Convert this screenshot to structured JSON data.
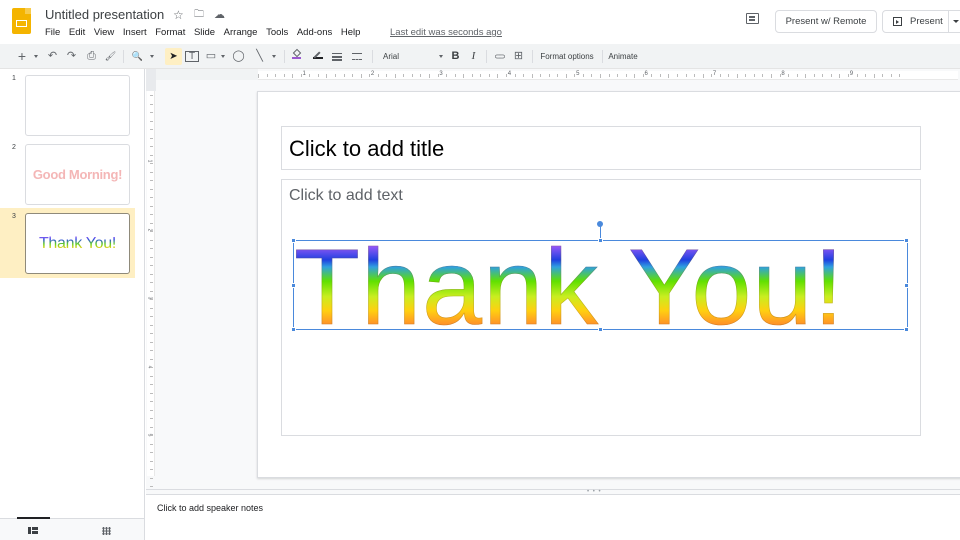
{
  "app": {
    "document_title": "Untitled presentation",
    "menu": [
      "File",
      "Edit",
      "View",
      "Insert",
      "Format",
      "Slide",
      "Arrange",
      "Tools",
      "Add-ons",
      "Help"
    ],
    "last_edit": "Last edit was seconds ago",
    "present_remote_label": "Present w/ Remote",
    "present_label": "Present",
    "icons": {
      "star": "☆",
      "move": "🗀",
      "cloud": "☁"
    }
  },
  "toolbar": {
    "font": "Arial",
    "bold": "B",
    "italic": "I",
    "format_options": "Format options",
    "animate": "Animate",
    "icons": {
      "new": "+",
      "undo": "↶",
      "redo": "↷",
      "print": "⎙",
      "paint_format": "🖌",
      "zoom": "🔍",
      "select": "➤",
      "textbox": "T",
      "image": "▭",
      "shape": "◯",
      "line": "╲",
      "link": "⊂⊃",
      "comment": "⊞"
    }
  },
  "filmstrip": {
    "slides": [
      {
        "number": "1",
        "text": ""
      },
      {
        "number": "2",
        "text": "Good Morning!"
      },
      {
        "number": "3",
        "text": "Thank You!"
      }
    ],
    "selected_index": 2
  },
  "ruler": {
    "horizontal_labels": [
      "1",
      "2",
      "3",
      "4",
      "5",
      "6",
      "7",
      "8",
      "9"
    ],
    "vertical_labels": [
      "1",
      "2",
      "3",
      "4",
      "5"
    ]
  },
  "slide": {
    "title_placeholder": "Click to add title",
    "body_placeholder": "Click to add text",
    "wordart_text": "Thank You!"
  },
  "notes": {
    "placeholder": "Click to add speaker notes"
  }
}
